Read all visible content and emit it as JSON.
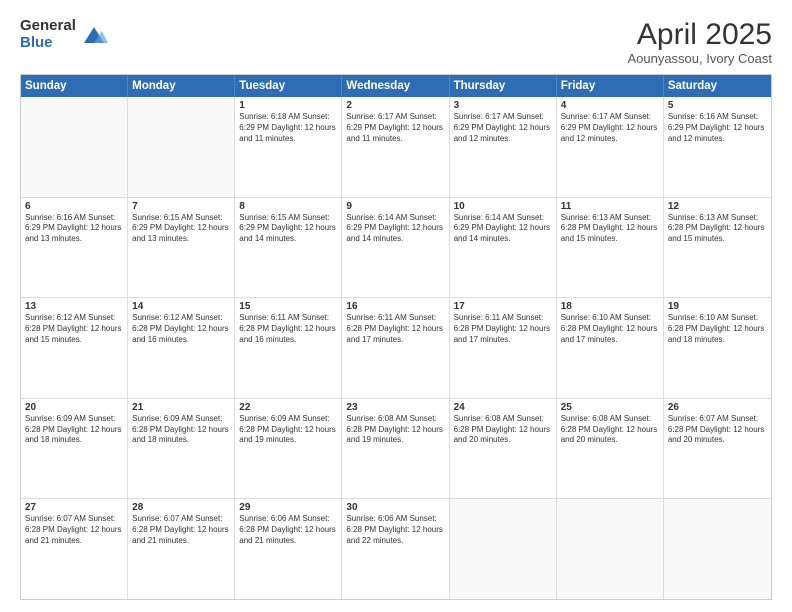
{
  "logo": {
    "general": "General",
    "blue": "Blue"
  },
  "title": "April 2025",
  "subtitle": "Aounyassou, Ivory Coast",
  "header_days": [
    "Sunday",
    "Monday",
    "Tuesday",
    "Wednesday",
    "Thursday",
    "Friday",
    "Saturday"
  ],
  "weeks": [
    [
      {
        "day": "",
        "text": ""
      },
      {
        "day": "",
        "text": ""
      },
      {
        "day": "1",
        "text": "Sunrise: 6:18 AM\nSunset: 6:29 PM\nDaylight: 12 hours and 11 minutes."
      },
      {
        "day": "2",
        "text": "Sunrise: 6:17 AM\nSunset: 6:29 PM\nDaylight: 12 hours and 11 minutes."
      },
      {
        "day": "3",
        "text": "Sunrise: 6:17 AM\nSunset: 6:29 PM\nDaylight: 12 hours and 12 minutes."
      },
      {
        "day": "4",
        "text": "Sunrise: 6:17 AM\nSunset: 6:29 PM\nDaylight: 12 hours and 12 minutes."
      },
      {
        "day": "5",
        "text": "Sunrise: 6:16 AM\nSunset: 6:29 PM\nDaylight: 12 hours and 12 minutes."
      }
    ],
    [
      {
        "day": "6",
        "text": "Sunrise: 6:16 AM\nSunset: 6:29 PM\nDaylight: 12 hours and 13 minutes."
      },
      {
        "day": "7",
        "text": "Sunrise: 6:15 AM\nSunset: 6:29 PM\nDaylight: 12 hours and 13 minutes."
      },
      {
        "day": "8",
        "text": "Sunrise: 6:15 AM\nSunset: 6:29 PM\nDaylight: 12 hours and 14 minutes."
      },
      {
        "day": "9",
        "text": "Sunrise: 6:14 AM\nSunset: 6:29 PM\nDaylight: 12 hours and 14 minutes."
      },
      {
        "day": "10",
        "text": "Sunrise: 6:14 AM\nSunset: 6:29 PM\nDaylight: 12 hours and 14 minutes."
      },
      {
        "day": "11",
        "text": "Sunrise: 6:13 AM\nSunset: 6:28 PM\nDaylight: 12 hours and 15 minutes."
      },
      {
        "day": "12",
        "text": "Sunrise: 6:13 AM\nSunset: 6:28 PM\nDaylight: 12 hours and 15 minutes."
      }
    ],
    [
      {
        "day": "13",
        "text": "Sunrise: 6:12 AM\nSunset: 6:28 PM\nDaylight: 12 hours and 15 minutes."
      },
      {
        "day": "14",
        "text": "Sunrise: 6:12 AM\nSunset: 6:28 PM\nDaylight: 12 hours and 16 minutes."
      },
      {
        "day": "15",
        "text": "Sunrise: 6:11 AM\nSunset: 6:28 PM\nDaylight: 12 hours and 16 minutes."
      },
      {
        "day": "16",
        "text": "Sunrise: 6:11 AM\nSunset: 6:28 PM\nDaylight: 12 hours and 17 minutes."
      },
      {
        "day": "17",
        "text": "Sunrise: 6:11 AM\nSunset: 6:28 PM\nDaylight: 12 hours and 17 minutes."
      },
      {
        "day": "18",
        "text": "Sunrise: 6:10 AM\nSunset: 6:28 PM\nDaylight: 12 hours and 17 minutes."
      },
      {
        "day": "19",
        "text": "Sunrise: 6:10 AM\nSunset: 6:28 PM\nDaylight: 12 hours and 18 minutes."
      }
    ],
    [
      {
        "day": "20",
        "text": "Sunrise: 6:09 AM\nSunset: 6:28 PM\nDaylight: 12 hours and 18 minutes."
      },
      {
        "day": "21",
        "text": "Sunrise: 6:09 AM\nSunset: 6:28 PM\nDaylight: 12 hours and 18 minutes."
      },
      {
        "day": "22",
        "text": "Sunrise: 6:09 AM\nSunset: 6:28 PM\nDaylight: 12 hours and 19 minutes."
      },
      {
        "day": "23",
        "text": "Sunrise: 6:08 AM\nSunset: 6:28 PM\nDaylight: 12 hours and 19 minutes."
      },
      {
        "day": "24",
        "text": "Sunrise: 6:08 AM\nSunset: 6:28 PM\nDaylight: 12 hours and 20 minutes."
      },
      {
        "day": "25",
        "text": "Sunrise: 6:08 AM\nSunset: 6:28 PM\nDaylight: 12 hours and 20 minutes."
      },
      {
        "day": "26",
        "text": "Sunrise: 6:07 AM\nSunset: 6:28 PM\nDaylight: 12 hours and 20 minutes."
      }
    ],
    [
      {
        "day": "27",
        "text": "Sunrise: 6:07 AM\nSunset: 6:28 PM\nDaylight: 12 hours and 21 minutes."
      },
      {
        "day": "28",
        "text": "Sunrise: 6:07 AM\nSunset: 6:28 PM\nDaylight: 12 hours and 21 minutes."
      },
      {
        "day": "29",
        "text": "Sunrise: 6:06 AM\nSunset: 6:28 PM\nDaylight: 12 hours and 21 minutes."
      },
      {
        "day": "30",
        "text": "Sunrise: 6:06 AM\nSunset: 6:28 PM\nDaylight: 12 hours and 22 minutes."
      },
      {
        "day": "",
        "text": ""
      },
      {
        "day": "",
        "text": ""
      },
      {
        "day": "",
        "text": ""
      }
    ]
  ]
}
